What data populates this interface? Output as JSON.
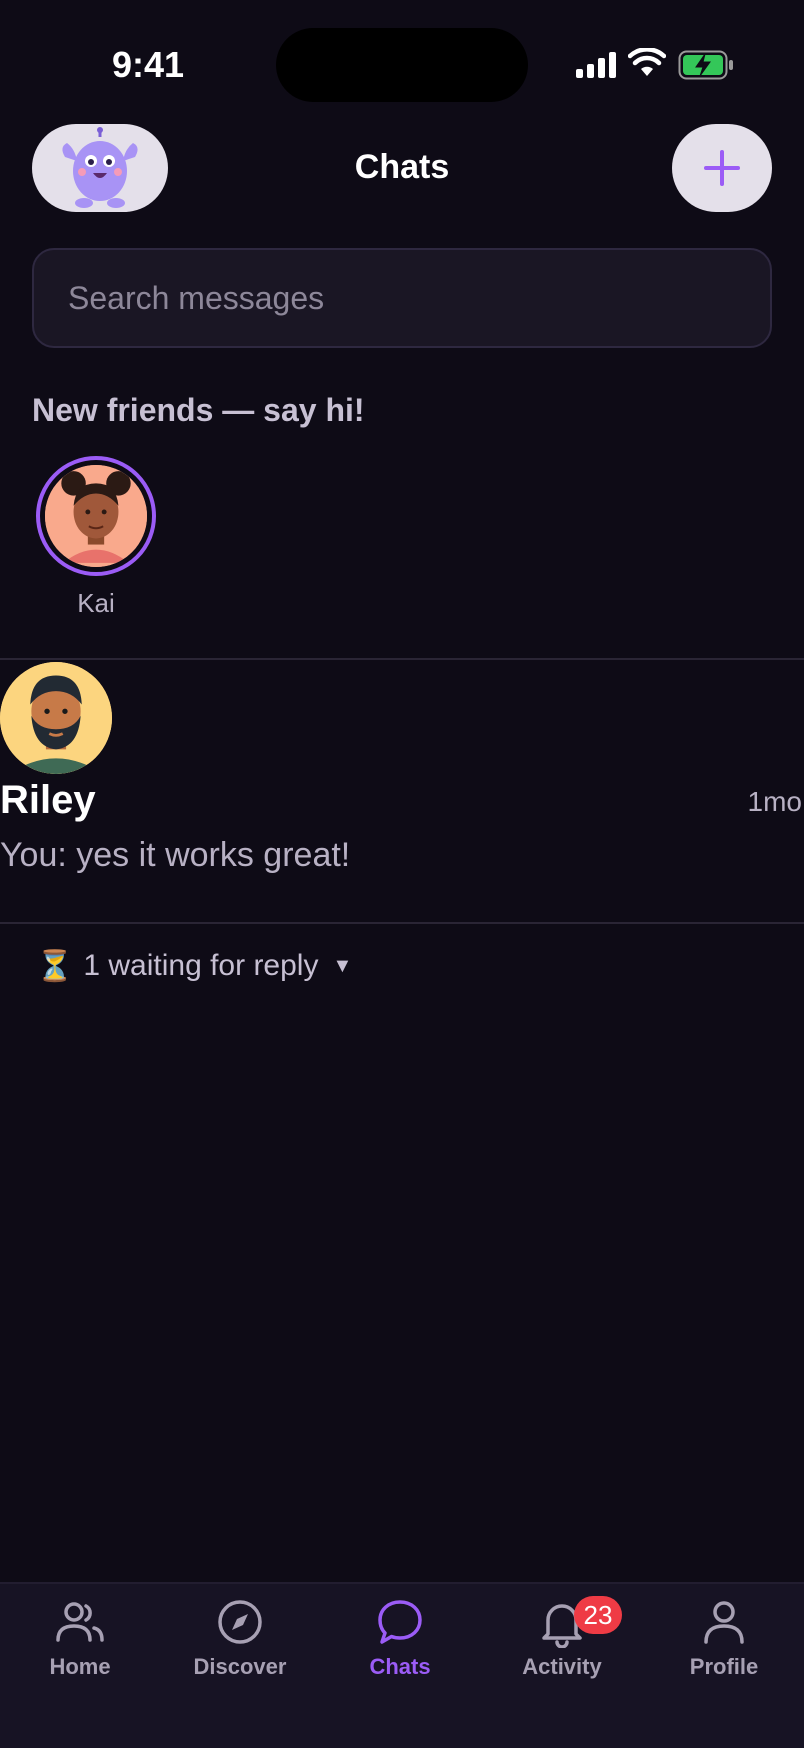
{
  "status_bar": {
    "time": "9:41"
  },
  "header": {
    "title": "Chats"
  },
  "search": {
    "placeholder": "Search messages"
  },
  "new_friends": {
    "title": "New friends — say hi!",
    "friends": [
      {
        "name": "Kai"
      }
    ]
  },
  "chats": [
    {
      "name": "Riley",
      "time": "1mo",
      "preview": "You: yes it works great!"
    }
  ],
  "waiting": {
    "icon": "⏳",
    "label": "1 waiting for reply"
  },
  "tab_bar": {
    "tabs": [
      {
        "label": "Home",
        "icon": "people-icon"
      },
      {
        "label": "Discover",
        "icon": "compass-icon"
      },
      {
        "label": "Chats",
        "icon": "chat-bubble-icon",
        "active": true
      },
      {
        "label": "Activity",
        "icon": "bell-icon",
        "badge": "23"
      },
      {
        "label": "Profile",
        "icon": "person-icon"
      }
    ]
  },
  "colors": {
    "accent": "#9b5cf6",
    "background": "#0e0b16",
    "badge": "#ef3b45"
  }
}
